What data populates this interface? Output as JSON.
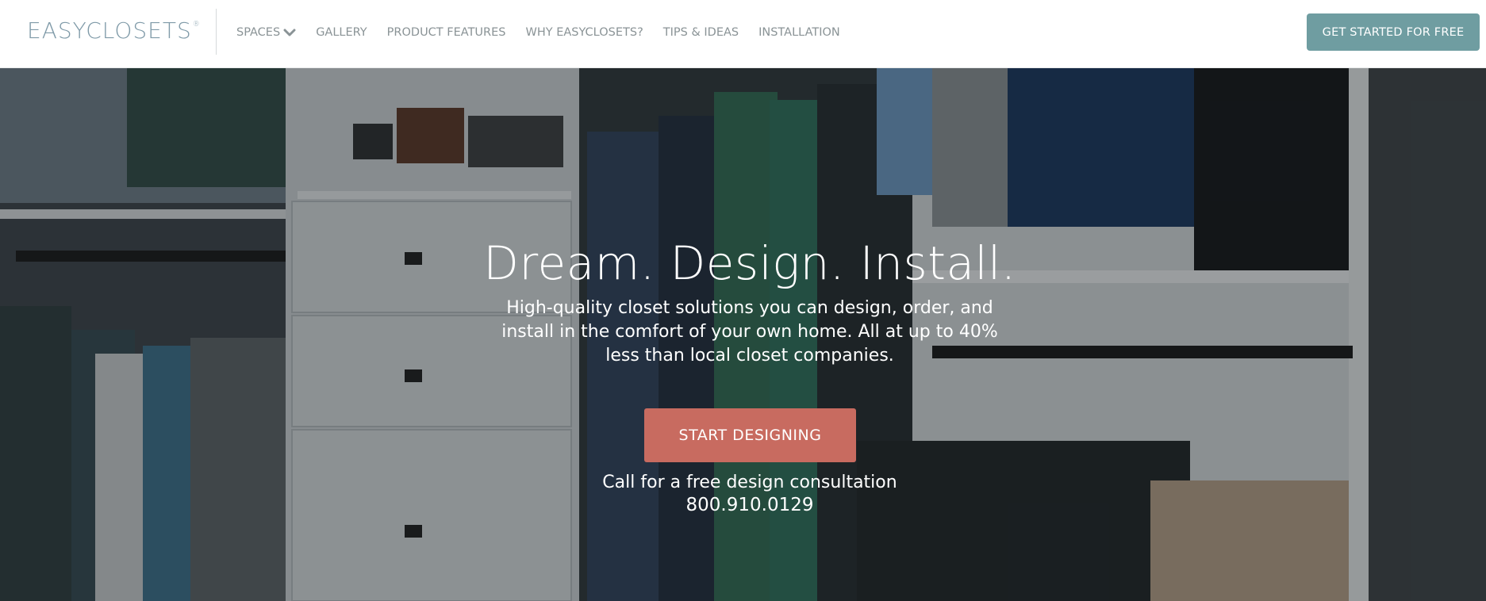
{
  "header": {
    "logo": "EASYCLOSETS",
    "logo_mark": "®",
    "nav": [
      {
        "label": "SPACES",
        "has_dropdown": true
      },
      {
        "label": "GALLERY"
      },
      {
        "label": "PRODUCT FEATURES"
      },
      {
        "label": "WHY EASYCLOSETS?"
      },
      {
        "label": "TIPS & IDEAS"
      },
      {
        "label": "INSTALLATION"
      }
    ],
    "cta_label": "GET STARTED FOR FREE"
  },
  "hero": {
    "title": "Dream. Design. Install.",
    "subtitle": "High-quality closet solutions you can design, order, and install in the comfort of your own home. All at up to 40% less than local closet companies.",
    "cta_label": "START DESIGNING",
    "call_text": "Call for a free design consultation",
    "phone": "800.910.0129"
  },
  "icons": {
    "dropdown": "chevron-down-icon"
  },
  "colors": {
    "logo": "#7f9aa8",
    "nav_text": "#8a9396",
    "header_cta": "#6f9da1",
    "hero_cta": "#c86b60"
  }
}
